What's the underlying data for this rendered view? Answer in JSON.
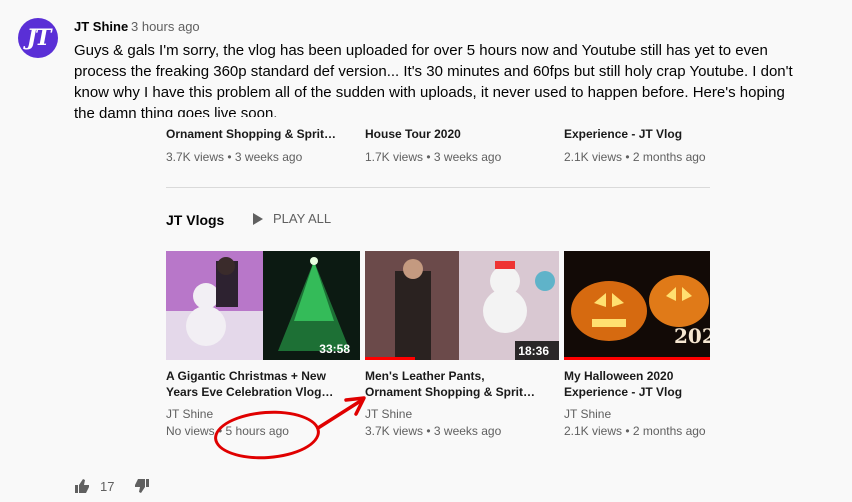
{
  "comment": {
    "author": "JT Shine",
    "time": "3 hours ago",
    "avatar_initials": "JT",
    "text": "Guys & gals I'm sorry, the vlog has been uploaded for over 5 hours now and Youtube still has yet to even process the freaking 360p standard def version... It's 30 minutes and 60fps but still holy crap Youtube. I don't know why I have this problem all of the sudden with uploads, it never used to happen before. Here's hoping the damn thing goes live soon.",
    "likes": "17"
  },
  "screenshot": {
    "top_row": [
      {
        "title": "Ornament Shopping & Sprit…",
        "meta": "3.7K views • 3 weeks ago"
      },
      {
        "title": "House Tour 2020",
        "meta": "1.7K views • 3 weeks ago"
      },
      {
        "title": "Experience - JT Vlog",
        "meta": "2.1K views • 2 months ago"
      }
    ],
    "section": {
      "title": "JT Vlogs",
      "play_all": "PLAY ALL"
    },
    "videos": [
      {
        "title_line1": "A Gigantic Christmas + New",
        "title_line2": "Years Eve Celebration Vlog…",
        "channel": "JT Shine",
        "meta": "No views • 5 hours ago",
        "duration": "33:58"
      },
      {
        "title_line1": "Men's Leather Pants,",
        "title_line2": "Ornament Shopping & Sprit…",
        "channel": "JT Shine",
        "meta": "3.7K views • 3 weeks ago",
        "duration": "18:36"
      },
      {
        "title_line1": "My Halloween 2020",
        "title_line2": "Experience - JT Vlog",
        "channel": "JT Shine",
        "meta": "2.1K views • 2 months ago",
        "duration": ""
      }
    ]
  },
  "colors": {
    "accent": "#ff0000",
    "annotation": "#e00000",
    "avatar": "#5a2fd6"
  }
}
